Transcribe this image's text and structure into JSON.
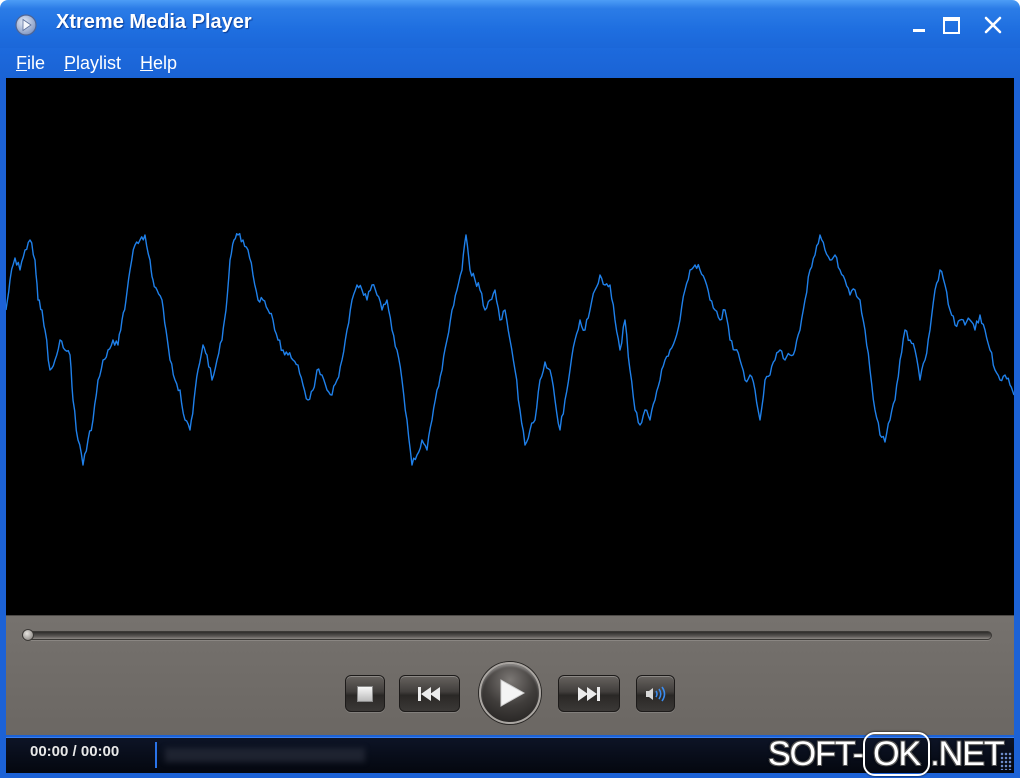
{
  "window": {
    "title": "Xtreme Media Player",
    "app_icon": "media-player-icon"
  },
  "title_controls": {
    "minimize": "minimize-icon",
    "maximize": "maximize-icon",
    "close": "close-icon"
  },
  "menu": {
    "items": [
      {
        "label": "File"
      },
      {
        "label": "Playlist"
      },
      {
        "label": "Help"
      }
    ]
  },
  "video": {
    "visualization": "waveform",
    "wave_color": "#1f80ea"
  },
  "seek": {
    "position_fraction": 0
  },
  "transport": {
    "stop": "stop-icon",
    "previous": "previous-track-icon",
    "play": "play-icon",
    "next": "next-track-icon",
    "volume": "volume-icon"
  },
  "status": {
    "time": "00:00 / 00:00"
  },
  "watermark": {
    "prefix": "SOFT-",
    "boxed": "OK",
    "suffix": ".NET"
  },
  "colors": {
    "frame": "#1c62d6",
    "video_background": "#000000",
    "control_panel": "#6f6b67",
    "status_background": "#070b16"
  }
}
